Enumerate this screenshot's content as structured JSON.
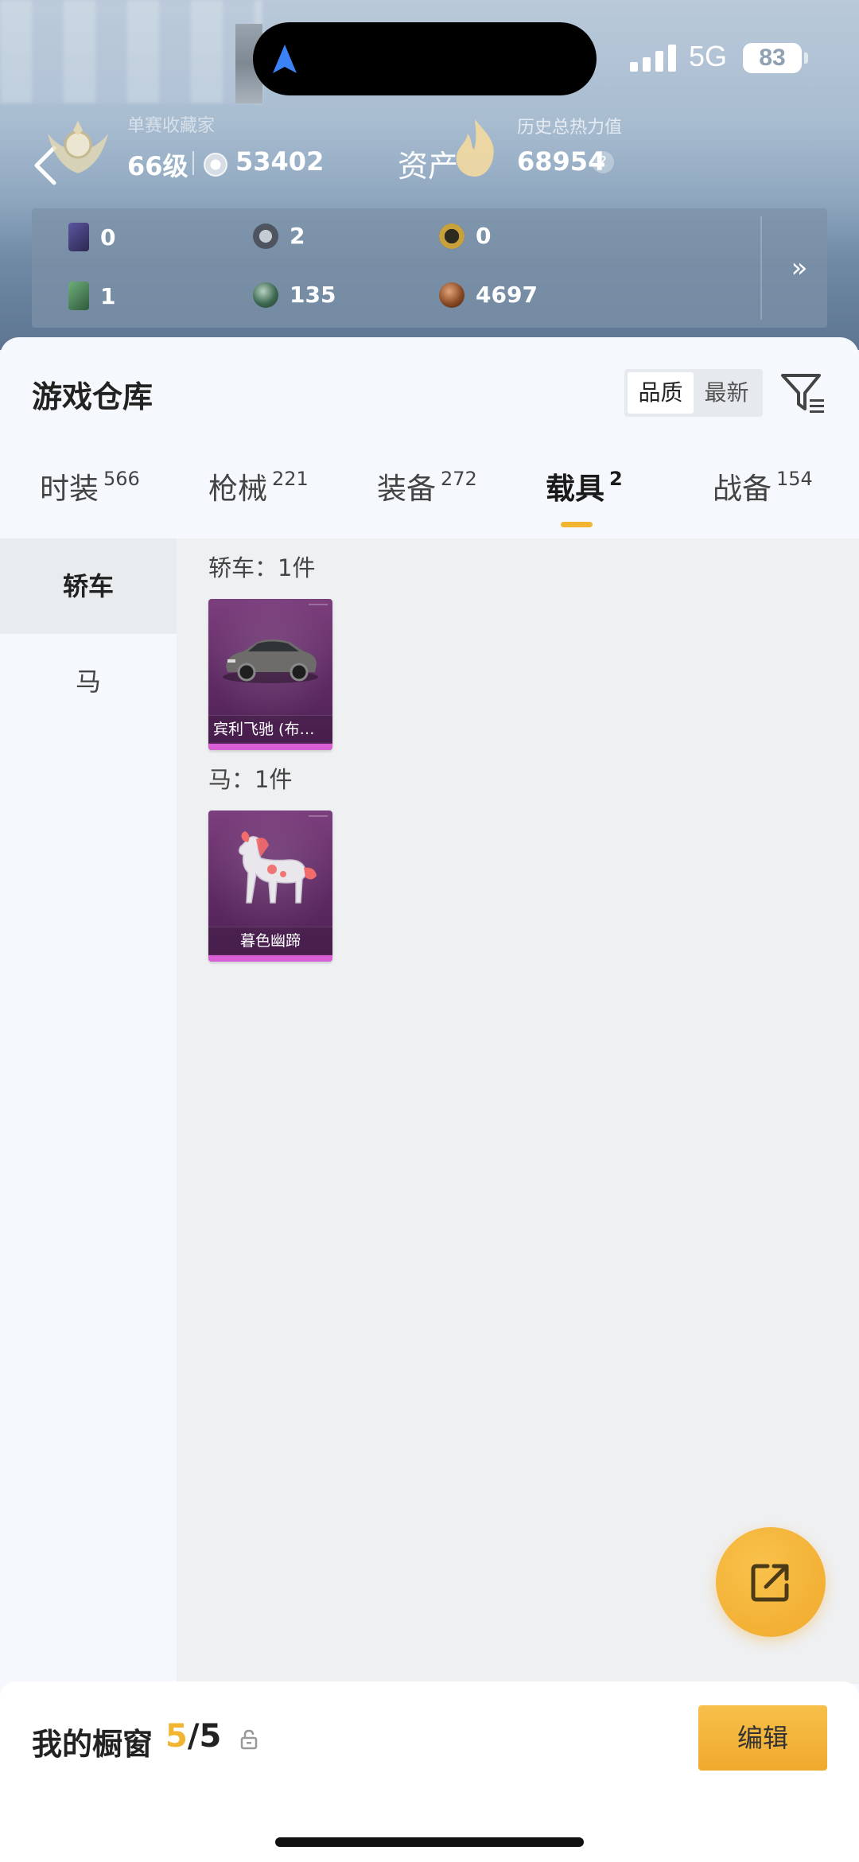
{
  "status_bar": {
    "network": "5G",
    "battery": "83"
  },
  "hero": {
    "faded_text": "单赛收藏家",
    "level": "66级",
    "coins": "53402",
    "asset_label": "资产",
    "history_label": "历史总热力值",
    "history_value": "68954",
    "help": "?"
  },
  "currency": {
    "items": [
      {
        "value": "0",
        "icon": "purple-card-icon",
        "color": "#3d3a66"
      },
      {
        "value": "2",
        "icon": "silver-coin-icon",
        "color": "#5c6470"
      },
      {
        "value": "0",
        "icon": "gold-token-icon",
        "color": "#8a6b24"
      },
      {
        "value": "1",
        "icon": "green-card-icon",
        "color": "#3d6b4a"
      },
      {
        "value": "135",
        "icon": "green-orb-icon",
        "color": "#456a55"
      },
      {
        "value": "4697",
        "icon": "bronze-coin-icon",
        "color": "#7a4a2a"
      }
    ],
    "more": "»"
  },
  "warehouse": {
    "title": "游戏仓库",
    "sort": {
      "quality": "品质",
      "newest": "最新"
    },
    "tabs": [
      {
        "label": "时装",
        "count": "566"
      },
      {
        "label": "枪械",
        "count": "221"
      },
      {
        "label": "装备",
        "count": "272"
      },
      {
        "label": "载具",
        "count": "2"
      },
      {
        "label": "战备",
        "count": "154"
      }
    ],
    "sidebar": [
      {
        "label": "轿车"
      },
      {
        "label": "马"
      }
    ],
    "groups": [
      {
        "title": "轿车：1件",
        "item_name": "宾利飞驰 (布加迪)"
      },
      {
        "title": "马：1件",
        "item_name": "暮色幽蹄"
      }
    ]
  },
  "bottom": {
    "showcase_label": "我的橱窗",
    "current": "5",
    "total": "/5",
    "edit": "编辑"
  },
  "colors": {
    "accent": "#f2b532",
    "rarity_purple": "#d85fd6"
  }
}
